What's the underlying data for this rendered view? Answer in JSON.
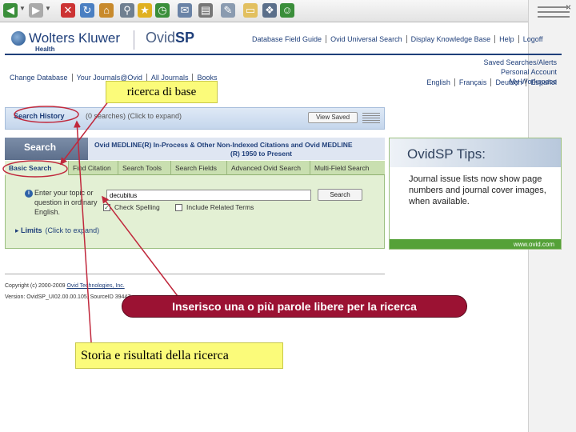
{
  "browser": {
    "toolbar_icons": [
      "back-icon",
      "forward-icon",
      "stop-icon",
      "refresh-icon",
      "home-icon",
      "search-icon",
      "favorites-icon",
      "history-icon",
      "mail-icon",
      "print-icon",
      "edit-icon",
      "folder-icon",
      "research-icon",
      "messenger-icon"
    ],
    "close_glyph": "×"
  },
  "header": {
    "brand_name": "Wolters Kluwer",
    "brand_sub": "Health",
    "product_prefix": "Ovid",
    "product_suffix": "SP",
    "links": [
      "Database Field Guide",
      "Ovid Universal Search",
      "Display Knowledge Base",
      "Help",
      "Logoff"
    ]
  },
  "nav": {
    "left_links": [
      "Change Database",
      "Your Journals@Ovid",
      "All Journals",
      "Books"
    ],
    "account_links": [
      "Saved Searches/Alerts",
      "Personal Account",
      "My Workspace"
    ],
    "languages": [
      "English",
      "Français",
      "Deutsch",
      "Español"
    ]
  },
  "history": {
    "title": "Search History",
    "hint": "(0 searches) (Click to expand)",
    "view_saved": "View Saved"
  },
  "search": {
    "tab_label": "Search",
    "database_line1": "Ovid MEDLINE(R) In-Process & Other Non-Indexed Citations and Ovid MEDLINE",
    "database_line2": "(R) 1950 to Present",
    "modes": [
      "Basic Search",
      "Find Citation",
      "Search Tools",
      "Search Fields",
      "Advanced Ovid Search",
      "Multi-Field Search"
    ],
    "prompt": "Enter your topic or question in ordinary English.",
    "input_value": "decubitus",
    "button_label": "Search",
    "option_spelling": "Check Spelling",
    "option_related": "Include Related Terms",
    "limits_label": "Limits",
    "limits_hint": "(Click to expand)"
  },
  "tips": {
    "title": "OvidSP Tips:",
    "text": "Journal issue lists now show page numbers and journal cover images, when available.",
    "url": "www.ovid.com"
  },
  "footer": {
    "copyright_prefix": "Copyright (c) 2000-2009",
    "copyright_link": "Ovid Technologies, Inc.",
    "version": "Version: OvidSP_UI02.00.00.105, SourceID 39447"
  },
  "annotations": {
    "base": "ricerca di base",
    "words": "Inserisco una o più parole libere per la ricerca",
    "history": "Storia e risultati della ricerca"
  },
  "colors": {
    "brand": "#1f3f7a",
    "callout_yellow": "#fbfb7a",
    "callout_red": "#9b1233",
    "arrow_red": "#c0283c"
  }
}
